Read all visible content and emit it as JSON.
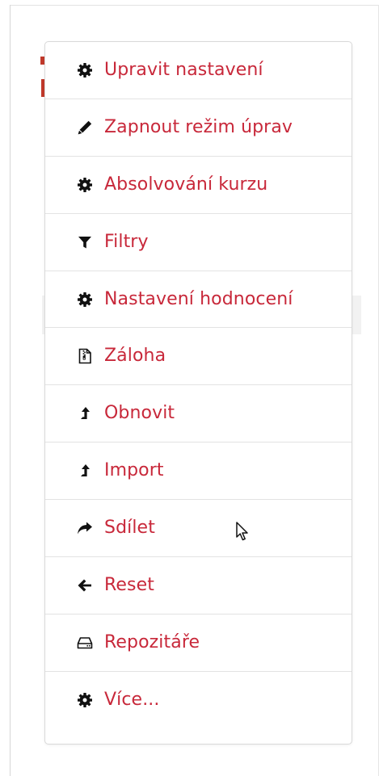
{
  "colors": {
    "accent": "#c8283a",
    "icon": "#111111",
    "divider": "#e3e3e3"
  },
  "menu": {
    "items": [
      {
        "label": "Upravit nastavení",
        "icon": "gear-icon"
      },
      {
        "label": "Zapnout režim úprav",
        "icon": "pencil-icon"
      },
      {
        "label": "Absolvování kurzu",
        "icon": "gear-icon"
      },
      {
        "label": "Filtry",
        "icon": "filter-icon"
      },
      {
        "label": "Nastavení hodnocení",
        "icon": "gear-icon"
      },
      {
        "label": "Záloha",
        "icon": "file-archive-icon"
      },
      {
        "label": "Obnovit",
        "icon": "level-up-icon"
      },
      {
        "label": "Import",
        "icon": "level-up-icon"
      },
      {
        "label": "Sdílet",
        "icon": "share-icon"
      },
      {
        "label": "Reset",
        "icon": "arrow-left-icon"
      },
      {
        "label": "Repozitáře",
        "icon": "hdd-icon"
      },
      {
        "label": "Více...",
        "icon": "gear-icon"
      }
    ]
  }
}
